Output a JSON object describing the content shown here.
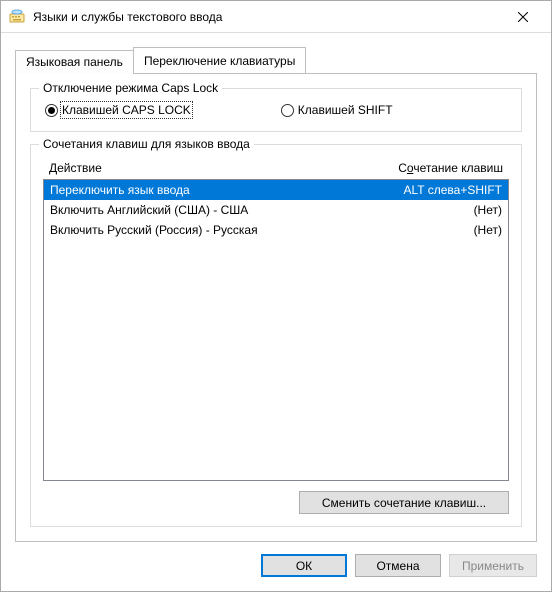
{
  "window": {
    "title": "Языки и службы текстового ввода"
  },
  "tabs": {
    "lang_panel": "Языковая панель",
    "key_switch": "Переключение клавиатуры",
    "active": "key_switch"
  },
  "capslock_group": {
    "legend": "Отключение режима Caps Lock",
    "radio_caps": "Клавишей CAPS LOCK",
    "radio_shift": "Клавишей SHIFT",
    "selected": "caps"
  },
  "hotkeys_group": {
    "legend": "Сочетания клавиш для языков ввода",
    "header_action": "Действие",
    "header_combo_pre": "С",
    "header_combo_u": "о",
    "header_combo_post": "четание клавиш",
    "rows": [
      {
        "action": "Переключить язык ввода",
        "combo": "ALT слева+SHIFT",
        "selected": true
      },
      {
        "action": "Включить Английский (США) - США",
        "combo": "(Нет)",
        "selected": false
      },
      {
        "action": "Включить Русский (Россия) - Русская",
        "combo": "(Нет)",
        "selected": false
      }
    ],
    "change_button": "Сменить сочетание клавиш..."
  },
  "buttons": {
    "ok": "ОК",
    "cancel": "Отмена",
    "apply": "Применить"
  }
}
